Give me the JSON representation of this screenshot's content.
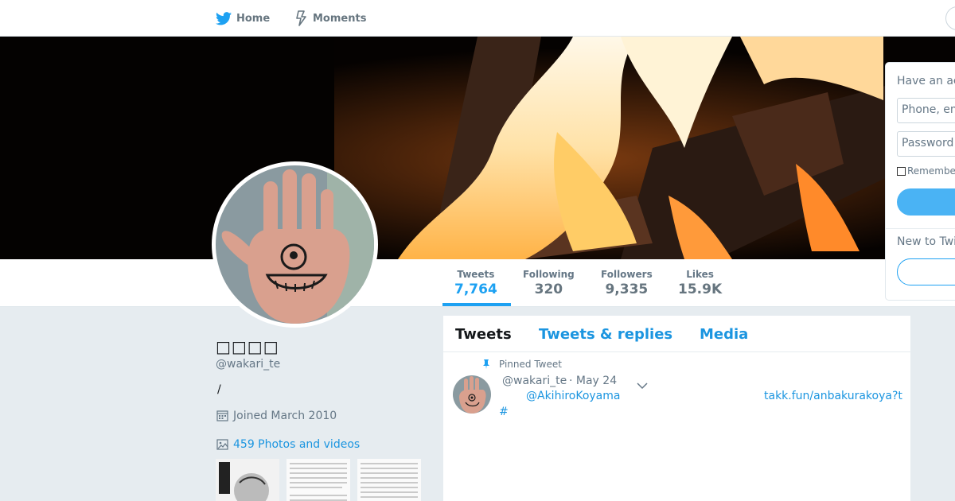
{
  "nav": {
    "home_label": "Home",
    "moments_label": "Moments"
  },
  "profile": {
    "name": "□□□□",
    "handle": "@wakari_te",
    "bio": "/",
    "joined": "Joined March 2010",
    "photos_link": "459 Photos and videos"
  },
  "stats": [
    {
      "label": "Tweets",
      "value": "7,764"
    },
    {
      "label": "Following",
      "value": "320"
    },
    {
      "label": "Followers",
      "value": "9,335"
    },
    {
      "label": "Likes",
      "value": "15.9K"
    }
  ],
  "timeline": {
    "tabs": [
      "Tweets",
      "Tweets & replies",
      "Media"
    ],
    "pinned_label": "Pinned Tweet",
    "tweet": {
      "handle": "@wakari_te",
      "date": "· May 24",
      "mention": "@AkihiroKoyama",
      "link": "takk.fun/anbakurakoya?t",
      "hashtag": "#"
    }
  },
  "login": {
    "title": "Have an ac",
    "phone_placeholder": "Phone, em",
    "password_placeholder": "Password",
    "remember_label": "Remembe",
    "new_label": "New to Twi"
  },
  "colors": {
    "accent": "#1da1f2",
    "link": "#1b95e0",
    "background": "#e6ecf0"
  },
  "icons": {
    "home": "twitter-bird-icon",
    "moments": "lightning-icon",
    "joined": "calendar-icon",
    "photos": "image-icon",
    "pinned": "pin-icon",
    "caret": "chevron-down-icon"
  }
}
